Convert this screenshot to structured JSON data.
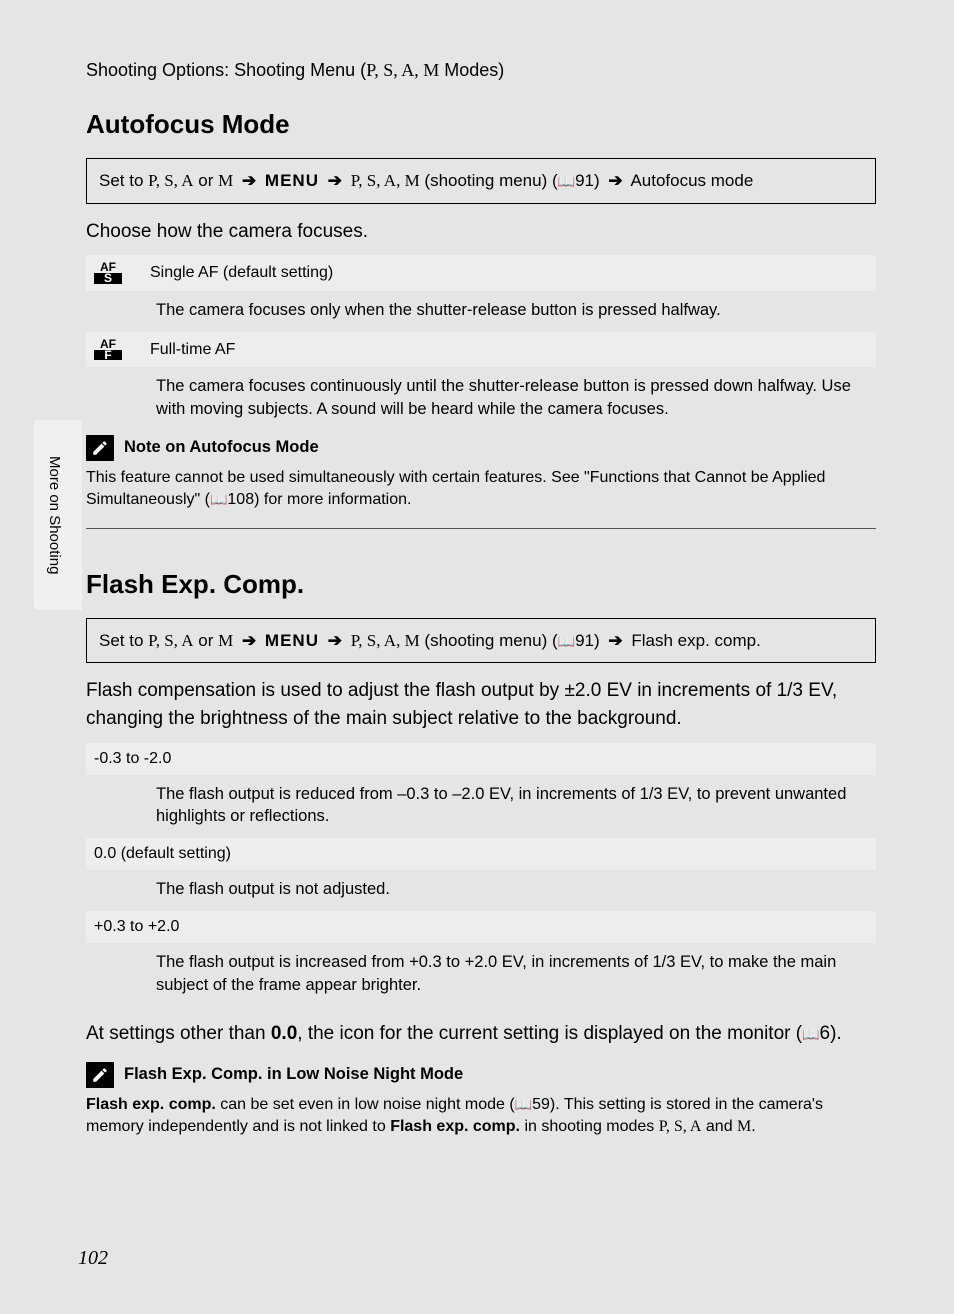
{
  "breadcrumb": {
    "prefix": "Shooting Options: Shooting Menu (",
    "modes": "P, S, A, M",
    "suffix": " Modes)"
  },
  "sideTab": "More on Shooting",
  "section1": {
    "title": "Autofocus Mode",
    "nav": {
      "set_to": "Set to ",
      "modes1": "P, S, A",
      "or": " or ",
      "modeM": "M",
      "menu": "MENU",
      "modes2": "P, S, A, M",
      "shooting_menu": " (shooting menu) (",
      "ref": "91",
      "end": ") ",
      "dest": "Autofocus mode"
    },
    "intro": "Choose how the camera focuses.",
    "options": [
      {
        "icon_top": "AF",
        "icon_bottom": "S",
        "title": "Single AF (default setting)",
        "desc": "The camera focuses only when the shutter-release button is pressed halfway."
      },
      {
        "icon_top": "AF",
        "icon_bottom": "F",
        "title": "Full-time AF",
        "desc": "The camera focuses continuously until the shutter-release button is pressed down halfway. Use with moving subjects. A sound will be heard while the camera focuses."
      }
    ],
    "note": {
      "title": "Note on Autofocus Mode",
      "body_a": "This feature cannot be used simultaneously with certain features. See \"Functions that Cannot be Applied Simultaneously\" (",
      "ref": "108",
      "body_b": ") for more information."
    }
  },
  "section2": {
    "title": "Flash Exp. Comp.",
    "nav": {
      "set_to": "Set to ",
      "modes1": "P, S, A",
      "or": " or ",
      "modeM": "M",
      "menu": "MENU",
      "modes2": "P, S, A, M",
      "shooting_menu": " (shooting menu) (",
      "ref": "91",
      "end": ") ",
      "dest": "Flash exp. comp."
    },
    "intro": "Flash compensation is used to adjust the flash output by ±2.0 EV in increments of 1/3 EV, changing the brightness of the main subject relative to the background.",
    "options": [
      {
        "label": "-0.3 to -2.0",
        "desc": "The flash output is reduced from –0.3 to –2.0 EV, in increments of 1/3 EV, to prevent unwanted highlights or reflections."
      },
      {
        "label": "0.0 (default setting)",
        "desc": "The flash output is not adjusted."
      },
      {
        "label": "+0.3 to +2.0",
        "desc": "The flash output is increased from +0.3 to +2.0 EV, in increments of 1/3 EV, to make the main subject of the frame appear brighter."
      }
    ],
    "after": {
      "a": "At settings other than ",
      "bold": "0.0",
      "b": ", the icon for the current setting is displayed on the monitor (",
      "ref": "6",
      "c": ")."
    },
    "note": {
      "title": "Flash Exp. Comp. in Low Noise Night Mode",
      "body_a_bold": "Flash exp. comp.",
      "body_a": " can be set even in low noise night mode (",
      "ref": "59",
      "body_b": "). This setting is stored in the camera's memory independently and is not linked to ",
      "body_b_bold": "Flash exp. comp.",
      "body_c": " in shooting modes ",
      "modes": "P, S, A",
      "body_d": " and ",
      "modeM": "M",
      "body_e": "."
    }
  },
  "pageNumber": "102"
}
